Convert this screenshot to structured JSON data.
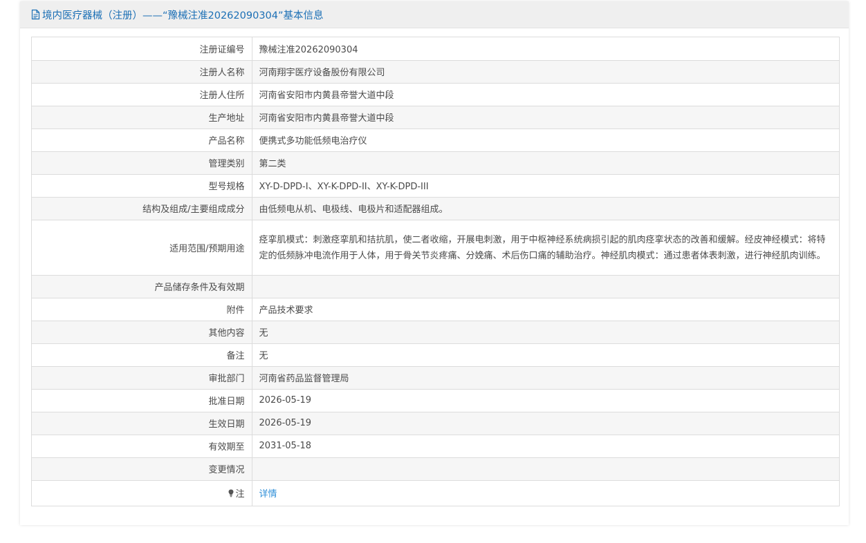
{
  "header": {
    "title": "境内医疗器械（注册）——“豫械注准20262090304”基本信息",
    "icon": "document-icon"
  },
  "rows": [
    {
      "label": "注册证编号",
      "value": "豫械注准20262090304"
    },
    {
      "label": "注册人名称",
      "value": "河南翔宇医疗设备股份有限公司"
    },
    {
      "label": "注册人住所",
      "value": "河南省安阳市内黄县帝誉大道中段"
    },
    {
      "label": "生产地址",
      "value": "河南省安阳市内黄县帝誉大道中段"
    },
    {
      "label": "产品名称",
      "value": "便携式多功能低频电治疗仪"
    },
    {
      "label": "管理类别",
      "value": "第二类"
    },
    {
      "label": "型号规格",
      "value": "XY-D-DPD-I、XY-K-DPD-II、XY-K-DPD-III"
    },
    {
      "label": "结构及组成/主要组成成分",
      "value": "由低频电从机、电极线、电极片和适配器组成。"
    },
    {
      "label": "适用范围/预期用途",
      "value": "痉挛肌模式：刺激痉挛肌和拮抗肌，使二者收缩，开展电刺激，用于中枢神经系统病损引起的肌肉痉挛状态的改善和缓解。经皮神经模式：将特定的低频脉冲电流作用于人体，用于骨关节炎疼痛、分娩痛、术后伤口痛的辅助治疗。神经肌肉模式：通过患者体表刺激，进行神经肌肉训练。"
    },
    {
      "label": "产品储存条件及有效期",
      "value": ""
    },
    {
      "label": "附件",
      "value": "产品技术要求"
    },
    {
      "label": "其他内容",
      "value": "无"
    },
    {
      "label": "备注",
      "value": "无"
    },
    {
      "label": "审批部门",
      "value": "河南省药品监督管理局"
    },
    {
      "label": "批准日期",
      "value": "2026-05-19"
    },
    {
      "label": "生效日期",
      "value": "2026-05-19"
    },
    {
      "label": "有效期至",
      "value": "2031-05-18"
    },
    {
      "label": "变更情况",
      "value": ""
    }
  ],
  "note": {
    "label": "注",
    "icon": "lightbulb-icon",
    "link_text": "详情"
  },
  "colors": {
    "header_text": "#1b6fb5",
    "link": "#2f8fd8",
    "alt_row": "#f6f6f6",
    "border": "#dcdcdc"
  }
}
